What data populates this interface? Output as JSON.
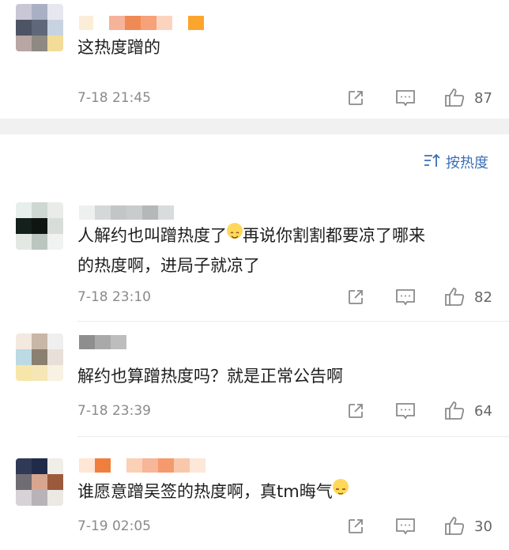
{
  "sort": {
    "label": "按热度"
  },
  "comments": [
    {
      "text": "这热度蹭的",
      "time": "7-18 21:45",
      "likes": "87"
    },
    {
      "text_line1": "人解约也叫蹭热度了",
      "text_line1b": "再说你割割都要凉了哪来",
      "text_line2": "的热度啊，进局子就凉了",
      "time": "7-18 23:10",
      "likes": "82"
    },
    {
      "text": "解约也算蹭热度吗？就是正常公告啊",
      "time": "7-18 23:39",
      "likes": "64"
    },
    {
      "text": "谁愿意蹭吴签的热度啊，真tm晦气",
      "time": "7-19 02:05",
      "likes": "30"
    }
  ],
  "icons": [
    "share-icon",
    "comment-icon",
    "like-icon",
    "sort-icon",
    "emoji-icon"
  ],
  "colors": {
    "accent": "#3b6fb6",
    "muted": "#8a8a8a"
  }
}
